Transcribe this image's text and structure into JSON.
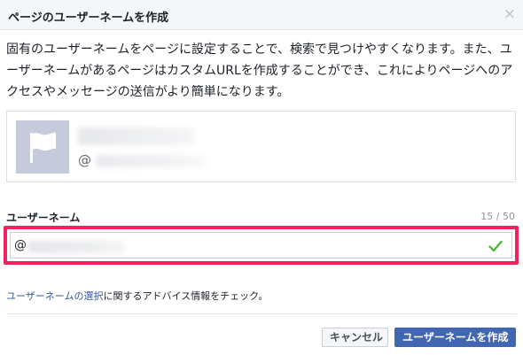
{
  "dialog": {
    "title": "ページのユーザーネームを作成",
    "close_icon": "close-icon"
  },
  "description": "固有のユーザーネームをページに設定することで、検索で見つけやすくなります。また、ユーザーネームがあるページはカスタムURLを作成することができ、これによりページへのアクセスやメッセージの送信がより簡単になります。",
  "preview": {
    "icon": "flag-icon",
    "handle_prefix": "@"
  },
  "username_field": {
    "label": "ユーザーネーム",
    "counter": "15 / 50",
    "prefix": "@",
    "status_icon": "check-icon",
    "status_color": "#42b72a",
    "highlight_color": "#f3215e"
  },
  "help": {
    "link_text": "ユーザーネームの選択",
    "text": "に関するアドバイス情報をチェック。"
  },
  "buttons": {
    "cancel": "キャンセル",
    "create": "ユーザーネームを作成"
  },
  "colors": {
    "primary": "#4267b2",
    "link": "#365899"
  }
}
